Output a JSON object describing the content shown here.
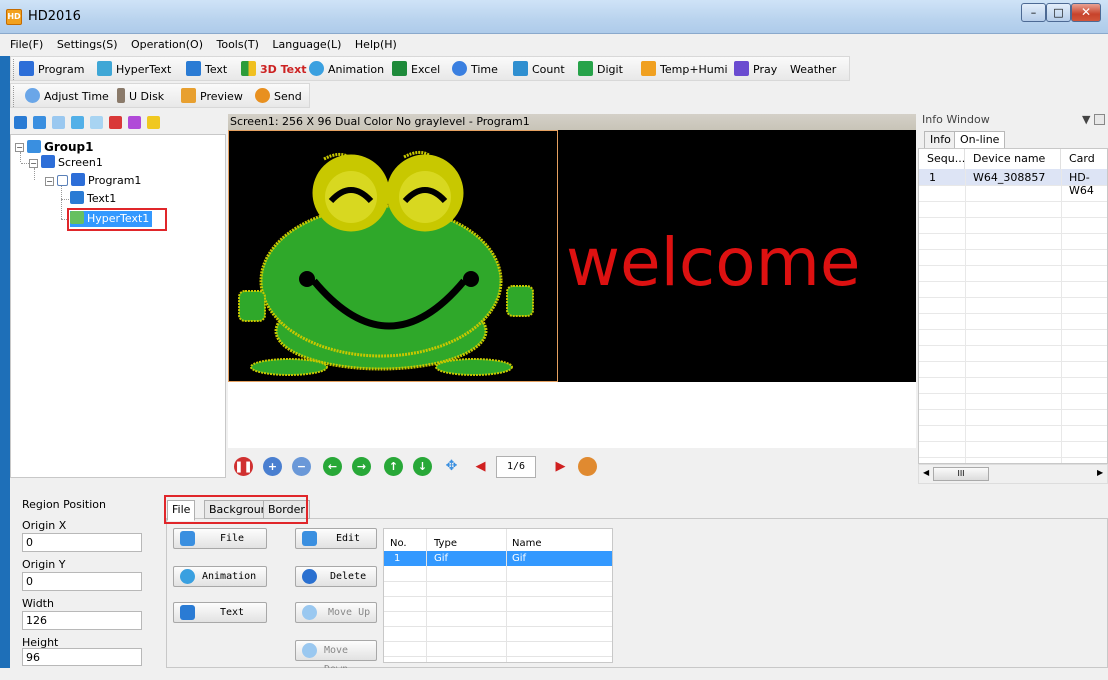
{
  "window": {
    "title": "HD2016",
    "icon_letter": "HD"
  },
  "menu": [
    "File(F)",
    "Settings(S)",
    "Operation(O)",
    "Tools(T)",
    "Language(L)",
    "Help(H)"
  ],
  "toolbar1": [
    {
      "label": "Program",
      "icon": "program-icon",
      "color": "#2d6ed8"
    },
    {
      "label": "HyperText",
      "icon": "hypertext-icon",
      "color": "#3fa7d6"
    },
    {
      "label": "Text",
      "icon": "text-icon",
      "color": "#2a7bd4"
    },
    {
      "label": "3D Text",
      "icon": "3d-text-icon",
      "color": "#2d9c3a"
    },
    {
      "label": "Animation",
      "icon": "animation-icon",
      "color": "#3aa0e0"
    },
    {
      "label": "Excel",
      "icon": "excel-icon",
      "color": "#1e8a3a"
    },
    {
      "label": "Time",
      "icon": "time-icon",
      "color": "#3a7fe0"
    },
    {
      "label": "Count",
      "icon": "count-icon",
      "color": "#2f8fd0"
    },
    {
      "label": "Digit",
      "icon": "digit-icon",
      "color": "#27a34a"
    },
    {
      "label": "Temp+Humi",
      "icon": "temperature-icon",
      "color": "#f0a020"
    },
    {
      "label": "Pray",
      "icon": "pray-icon",
      "color": "#6a4bd0"
    },
    {
      "label": "Weather",
      "icon": "weather-icon",
      "color": "none"
    }
  ],
  "toolbar2": [
    {
      "label": "Adjust Time",
      "icon": "adjust-time-icon",
      "color": "#6aa6e8"
    },
    {
      "label": "U Disk",
      "icon": "u-disk-icon",
      "color": "#8a7a6a"
    },
    {
      "label": "Preview",
      "icon": "preview-icon",
      "color": "#e8a030"
    },
    {
      "label": "Send",
      "icon": "send-icon",
      "color": "#e89020"
    }
  ],
  "tree": {
    "group": "Group1",
    "screen": "Screen1",
    "program": "Program1",
    "text": "Text1",
    "hypertext": "HyperText1"
  },
  "canvas": {
    "header": "Screen1: 256 X 96  Dual Color No graylevel - Program1",
    "welcome": "welcome",
    "page_indicator": "1/6"
  },
  "info": {
    "title": "Info Window",
    "pin": " ↓",
    "tabs": [
      "Info",
      "On-line"
    ],
    "columns": [
      "Sequ...",
      "Device name",
      "Card"
    ],
    "rows": [
      {
        "seq": "1",
        "device": "W64_308857",
        "card": "HD-W64"
      }
    ],
    "scroll_grip": "III"
  },
  "region": {
    "title": "Region Position",
    "origin_x_label": "Origin X",
    "origin_x": "0",
    "origin_y_label": "Origin Y",
    "origin_y": "0",
    "width_label": "Width",
    "width": "126",
    "height_label": "Height",
    "height": "96"
  },
  "bottom_tabs": [
    "File",
    "Background",
    "Border"
  ],
  "buttons": {
    "file": "File",
    "edit": "Edit",
    "animation": "Animation",
    "delete": "Delete",
    "text": "Text",
    "move_up": "Move Up",
    "move_down": "Move Down"
  },
  "file_table": {
    "columns": [
      "No.",
      "Type",
      "Name"
    ],
    "rows": [
      {
        "no": "1",
        "type": "Gif",
        "name": "Gif"
      }
    ]
  }
}
